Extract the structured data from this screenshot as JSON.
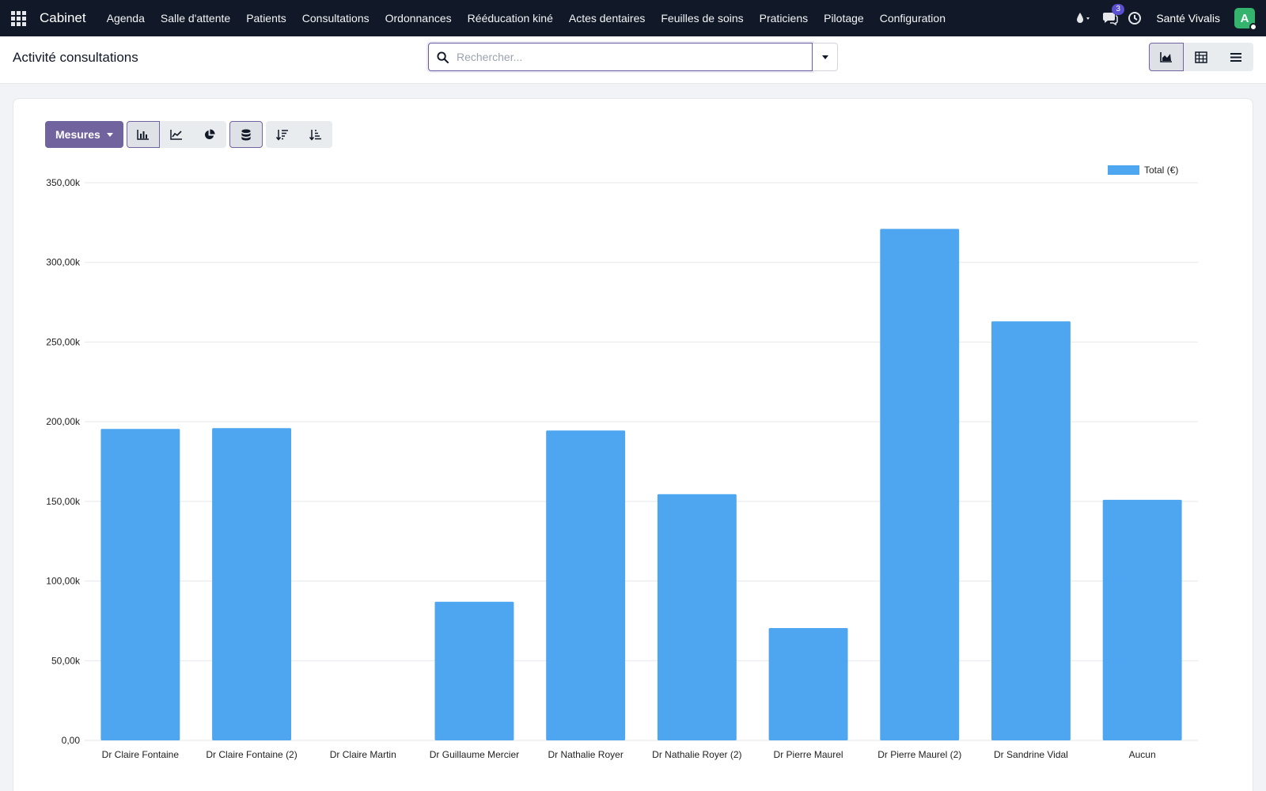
{
  "navbar": {
    "brand": "Cabinet",
    "menu": [
      "Agenda",
      "Salle d'attente",
      "Patients",
      "Consultations",
      "Ordonnances",
      "Rééducation kiné",
      "Actes dentaires",
      "Feuilles de soins",
      "Praticiens",
      "Pilotage",
      "Configuration"
    ],
    "messages_count": "3",
    "company": "Santé Vivalis",
    "avatar_letter": "A"
  },
  "control": {
    "title": "Activité consultations",
    "search_placeholder": "Rechercher..."
  },
  "toolbar": {
    "measures_label": "Mesures"
  },
  "chart_data": {
    "type": "bar",
    "categories": [
      "Dr Claire Fontaine",
      "Dr Claire Fontaine (2)",
      "Dr Claire Martin",
      "Dr Guillaume Mercier",
      "Dr Nathalie Royer",
      "Dr Nathalie Royer (2)",
      "Dr Pierre Maurel",
      "Dr Pierre Maurel (2)",
      "Dr Sandrine Vidal",
      "Aucun"
    ],
    "series": [
      {
        "name": "Total (€)",
        "values": [
          195500,
          196000,
          0,
          87000,
          194500,
          154500,
          70500,
          321000,
          263000,
          151000
        ],
        "color": "#4ea5f0"
      }
    ],
    "yticks": [
      "0,00",
      "50,00k",
      "100,00k",
      "150,00k",
      "200,00k",
      "250,00k",
      "300,00k",
      "350,00k"
    ],
    "ylim": [
      0,
      350000
    ],
    "grid": true,
    "legend": "top-right"
  }
}
